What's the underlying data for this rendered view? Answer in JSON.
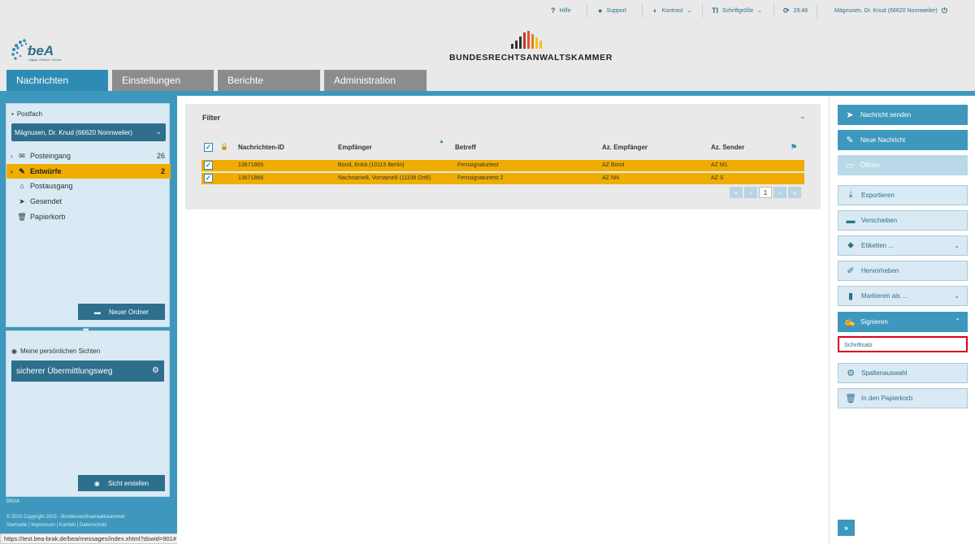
{
  "topbar": {
    "help": "Hilfe",
    "support": "Support",
    "contrast": "Kontrast",
    "fontsize": "Schriftgröße",
    "timer": "29:48",
    "user": "Mägnusen, Dr. Knud (66620 Nonnweiler)"
  },
  "header": {
    "logo_text": "beA",
    "logo_sub": "Digital. Einfach. Sicher.",
    "brak_name": "BUNDESRECHTSANWALTSKAMMER"
  },
  "nav": {
    "tabs": [
      "Nachrichten",
      "Einstellungen",
      "Berichte",
      "Administration"
    ],
    "active": "Nachrichten"
  },
  "sidebar": {
    "postfach_label": "Postfach",
    "mailbox": "Mägnusen, Dr. Knud (66620 Nonnweiler)",
    "folders": [
      {
        "label": "Posteingang",
        "count": "26",
        "icon": "envelope-icon"
      },
      {
        "label": "Entwürfe",
        "count": "2",
        "icon": "edit-icon"
      },
      {
        "label": "Postausgang",
        "count": "",
        "icon": "outbox-icon"
      },
      {
        "label": "Gesendet",
        "count": "",
        "icon": "sent-icon"
      },
      {
        "label": "Papierkorb",
        "count": "",
        "icon": "trash-icon"
      }
    ],
    "new_folder": "Neuer Ordner",
    "views_label": "Meine persönlichen Sichten",
    "view_item": "sicherer Übermittlungsweg",
    "create_view": "Sicht erstellen",
    "footer": {
      "brak_small": "BRAK",
      "copyright": "© 2022 Copyright 2015 - Bundesrechtsanwaltskammer",
      "links": "Startseite | Impressum | Kontakt | Datenschutz"
    }
  },
  "status_url": "https://test.bea-brak.de/bea/messages/index.xhtml?dswid=901#",
  "main": {
    "filter_title": "Filter",
    "columns": [
      "Nachrichten-ID",
      "Empfänger",
      "Betreff",
      "Az. Empfänger",
      "Az. Sender"
    ],
    "rows": [
      {
        "id": "13671865",
        "recipient": "Bond, Enkä (10115 Berlin)",
        "subject": "Fernsignaturtest",
        "az_recipient": "AZ Bond",
        "az_sender": "AZ M1"
      },
      {
        "id": "13671866",
        "recipient": "Nachname8, Vorname8 (11108 Ort8)",
        "subject": "Fernsignaturtest 2",
        "az_recipient": "AZ NN",
        "az_sender": "AZ S"
      }
    ],
    "pager": {
      "first": "«",
      "prev": "‹",
      "current": "1",
      "next": "›",
      "last": "»"
    }
  },
  "actions": {
    "send": "Nachricht senden",
    "new": "Neue Nachricht",
    "open": "Öffnen",
    "export": "Exportieren",
    "move": "Verschieben",
    "labels": "Etiketten ...",
    "highlight": "Hervorheben",
    "mark_as": "Markieren als ...",
    "sign": "Signieren",
    "sign_sub": "Schriftsatz",
    "columns": "Spaltenauswahl",
    "trash": "In den Papierkorb",
    "expand": "»"
  },
  "colors": {
    "accent": "#3e98bd",
    "dark_blue": "#2e6f8e",
    "highlight_row": "#f0ad00",
    "focus_border": "#d9001b"
  }
}
